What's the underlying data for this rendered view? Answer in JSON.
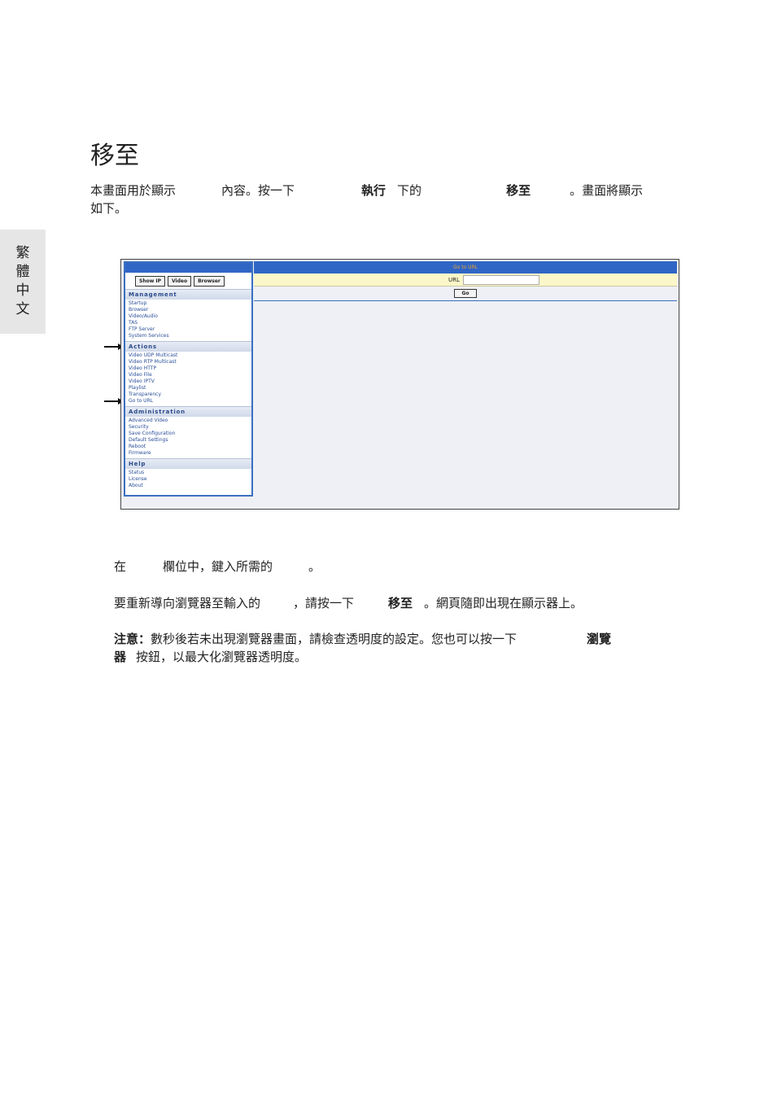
{
  "side_tab": [
    "繁",
    "體",
    "中",
    "文"
  ],
  "title": "移至",
  "intro": {
    "t1": "本畫面用於顯示",
    "t2": "內容。按一下",
    "b1": "執行",
    "t3": "下的",
    "b2": "移至",
    "t4": "。畫面將顯示",
    "line2": "如下。"
  },
  "screenshot": {
    "buttons": [
      "Show IP",
      "Video",
      "Browser"
    ],
    "sections": [
      {
        "title": "Management",
        "items": [
          "Startup",
          "Browser",
          "Video/Audio",
          "TAS",
          "FTP Server",
          "System Services"
        ]
      },
      {
        "title": "Actions",
        "items": [
          "Video UDP Multicast",
          "Video RTP Multicast",
          "Video HTTP",
          "Video File",
          "Video IPTV",
          "Playlist",
          "Transparency",
          "Go to URL"
        ]
      },
      {
        "title": "Administration",
        "items": [
          "Advanced Video",
          "Security",
          "Save Configuration",
          "Default Settings",
          "Reboot",
          "Firmware"
        ]
      },
      {
        "title": "Help",
        "items": [
          "Status",
          "License",
          "About"
        ]
      }
    ],
    "panel_title": "Go to URL",
    "url_label": "URL",
    "go_button": "Go"
  },
  "step1": {
    "t1": "在",
    "t2": "欄位中，鍵入所需的",
    "t3": "。"
  },
  "step2": {
    "t1": "要重新導向瀏覽器至輸入的",
    "t2": "，請按一下",
    "b1": "移至",
    "t3": "。網頁隨即出現在顯示器上。"
  },
  "note": {
    "b0": "注意：",
    "t1": "數秒後若未出現瀏覽器畫面，請檢查透明度的設定。您也可以按一下",
    "b1": "瀏覽",
    "b2": "器",
    "t2": "按鈕，以最大化瀏覽器透明度。"
  }
}
